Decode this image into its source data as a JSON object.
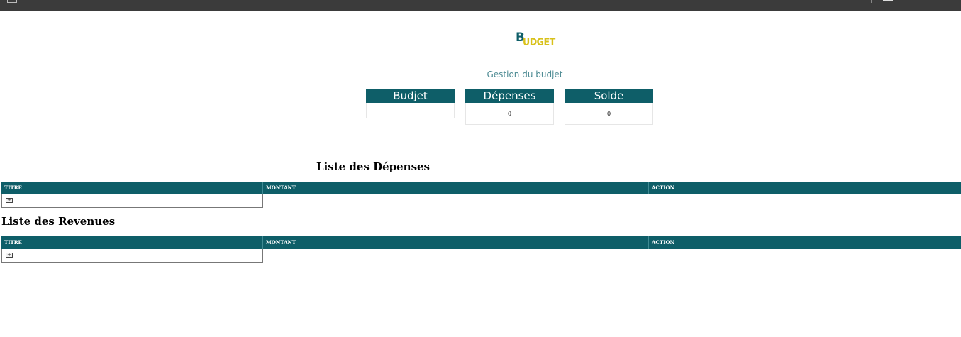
{
  "logo": {
    "first_letter": "B",
    "rest": "UDGET"
  },
  "subtitle": "Gestion du budjet",
  "cards": [
    {
      "label": "Budjet",
      "value": ""
    },
    {
      "label": "Dépenses",
      "value": "0"
    },
    {
      "label": "Solde",
      "value": "0"
    }
  ],
  "depenses": {
    "title": "Liste des Dépenses",
    "columns": [
      "TITRE",
      "MONTANT",
      "ACTION"
    ],
    "add_label": "+"
  },
  "revenues": {
    "title": "Liste des Revenues",
    "columns": [
      "TITRE",
      "MONTANT",
      "ACTION"
    ],
    "add_label": "+"
  },
  "colors": {
    "primary": "#0e5e68",
    "accent": "#d8c11b",
    "topbar": "#3b3b3b"
  }
}
